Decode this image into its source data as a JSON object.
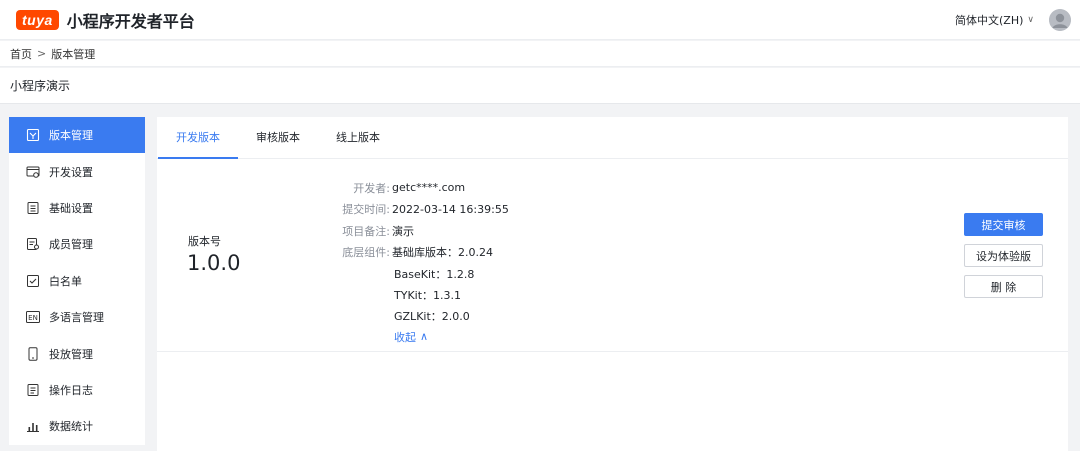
{
  "header": {
    "logo_text": "tuya",
    "app_title": "小程序开发者平台",
    "language": "简体中文(ZH)"
  },
  "breadcrumb": {
    "home": "首页",
    "separator": ">",
    "current": "版本管理"
  },
  "page_title": "小程序演示",
  "sidebar": {
    "items": [
      {
        "label": "版本管理",
        "icon": "version-icon",
        "active": true
      },
      {
        "label": "开发设置",
        "icon": "dev-settings-icon"
      },
      {
        "label": "基础设置",
        "icon": "basic-settings-icon"
      },
      {
        "label": "成员管理",
        "icon": "member-icon"
      },
      {
        "label": "白名单",
        "icon": "whitelist-icon"
      },
      {
        "label": "多语言管理",
        "icon": "language-icon"
      },
      {
        "label": "投放管理",
        "icon": "phone-icon"
      },
      {
        "label": "操作日志",
        "icon": "log-icon"
      },
      {
        "label": "数据统计",
        "icon": "stats-icon"
      }
    ]
  },
  "tabs": [
    {
      "label": "开发版本",
      "active": true
    },
    {
      "label": "审核版本"
    },
    {
      "label": "线上版本"
    }
  ],
  "version": {
    "label": "版本号",
    "number": "1.0.0",
    "developer_key": "开发者:",
    "developer": "getc****.com",
    "submit_time_key": "提交时间:",
    "submit_time": "2022-03-14 16:39:55",
    "note_key": "项目备注:",
    "note": "演示",
    "components_key": "底层组件:",
    "components": [
      "基础库版本：2.0.24",
      "BaseKit：1.2.8",
      "TYKit：1.3.1",
      "GZLKit：2.0.0"
    ],
    "collapse": "收起"
  },
  "actions": {
    "submit_review": "提交审核",
    "set_trial": "设为体验版",
    "delete": "删 除"
  },
  "colors": {
    "accent": "#3a7bf0",
    "brand": "#ff4800"
  }
}
